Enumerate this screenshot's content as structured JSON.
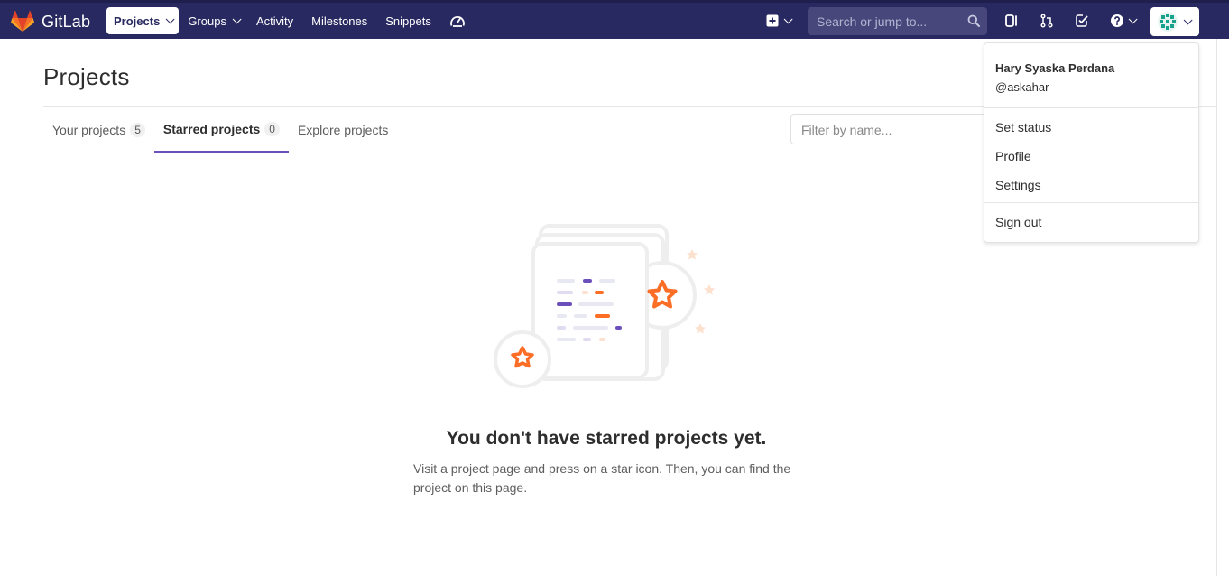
{
  "brand": {
    "name": "GitLab",
    "accent": "#292961",
    "tab_accent": "#6b4fbb",
    "logo_orange": "#e24329"
  },
  "nav": {
    "items": [
      {
        "label": "Projects",
        "has_dropdown": true,
        "active": true
      },
      {
        "label": "Groups",
        "has_dropdown": true,
        "active": false
      },
      {
        "label": "Activity",
        "has_dropdown": false,
        "active": false
      },
      {
        "label": "Milestones",
        "has_dropdown": false,
        "active": false
      },
      {
        "label": "Snippets",
        "has_dropdown": false,
        "active": false
      }
    ],
    "icons": [
      "dashboard-gauge-icon"
    ]
  },
  "header_right": {
    "new_icon": "plus-square-icon",
    "search_placeholder": "Search or jump to...",
    "tool_icons": [
      "issues-icon",
      "merge-request-icon",
      "todo-check-icon",
      "help-icon"
    ]
  },
  "page": {
    "title": "Projects",
    "tabs": [
      {
        "label": "Your projects",
        "count": "5",
        "active": false
      },
      {
        "label": "Starred projects",
        "count": "0",
        "active": true
      },
      {
        "label": "Explore projects",
        "count": null,
        "active": false
      }
    ],
    "filter_placeholder": "Filter by name..."
  },
  "empty_state": {
    "title": "You don't have starred projects yet.",
    "description": "Visit a project page and press on a star icon. Then, you can find the project on this page."
  },
  "user_menu": {
    "name": "Hary Syaska Perdana",
    "username": "@askahar",
    "items": [
      "Set status",
      "Profile",
      "Settings"
    ],
    "sign_out": "Sign out"
  }
}
